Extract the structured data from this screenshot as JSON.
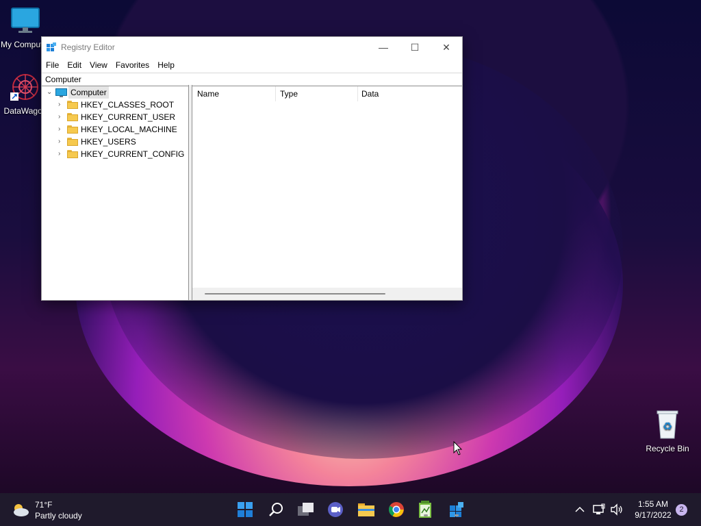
{
  "desktop": {
    "icons": [
      {
        "label": "My Computer"
      },
      {
        "label": "DataWagon"
      },
      {
        "label": "Recycle Bin"
      }
    ]
  },
  "window": {
    "title": "Registry Editor",
    "controls": {
      "minimize": "—",
      "maximize": "☐",
      "close": "✕"
    },
    "menu": [
      "File",
      "Edit",
      "View",
      "Favorites",
      "Help"
    ],
    "address": "Computer",
    "tree": {
      "root": "Computer",
      "children": [
        "HKEY_CLASSES_ROOT",
        "HKEY_CURRENT_USER",
        "HKEY_LOCAL_MACHINE",
        "HKEY_USERS",
        "HKEY_CURRENT_CONFIG"
      ]
    },
    "columns": [
      "Name",
      "Type",
      "Data"
    ]
  },
  "taskbar": {
    "weather": {
      "temp": "71°F",
      "desc": "Partly cloudy"
    },
    "apps": [
      "start-icon",
      "search-icon",
      "task-view-icon",
      "chat-icon",
      "file-explorer-icon",
      "chrome-icon",
      "notepad-icon",
      "registry-editor-icon"
    ],
    "clock": {
      "time": "1:55 AM",
      "date": "9/17/2022"
    },
    "notifications": "2"
  },
  "colors": {
    "accent": "#0078d4",
    "folder": "#f6c94e",
    "taskbar": "#1f1a2c"
  }
}
